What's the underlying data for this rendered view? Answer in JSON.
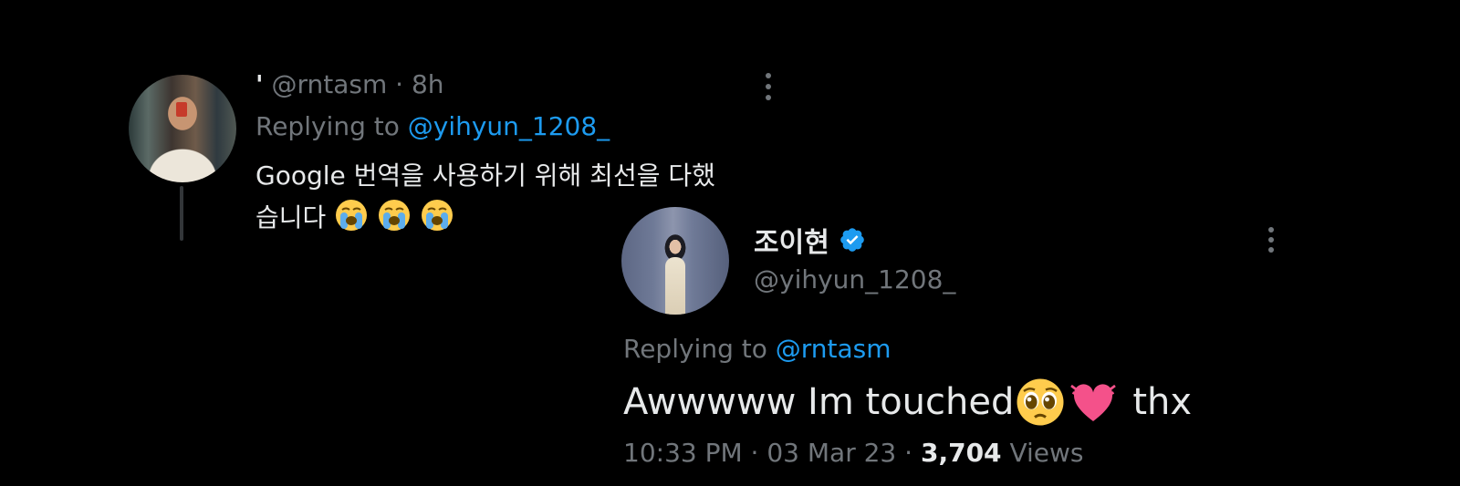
{
  "reply_tweet": {
    "display_name": "'",
    "handle": "@rntasm",
    "separator": "·",
    "time": "8h",
    "replying_prefix": "Replying to",
    "replying_to": "@yihyun_1208_",
    "text_line1": "Google 번역을 사용하기 위해 최선을 다했",
    "text_line2": "습니다",
    "emojis": [
      "crying-face",
      "crying-face",
      "crying-face"
    ],
    "more_icon": "more-vertical-icon"
  },
  "main_tweet": {
    "display_name": "조이현",
    "verified_icon": "verified-badge-icon",
    "handle": "@yihyun_1208_",
    "replying_prefix": "Replying to",
    "replying_to": "@rntasm",
    "text_part1": "Awwwww Im touched",
    "emojis": [
      "pleading-face",
      "beating-heart"
    ],
    "text_part2": "thx",
    "time": "10:33 PM",
    "separator": "·",
    "date": "03 Mar 23",
    "views_count": "3,704",
    "views_label": "Views",
    "more_icon": "more-vertical-icon"
  },
  "colors": {
    "background": "#000000",
    "primary_text": "#e7e9ea",
    "secondary_text": "#71767b",
    "accent": "#1d9bf0"
  }
}
